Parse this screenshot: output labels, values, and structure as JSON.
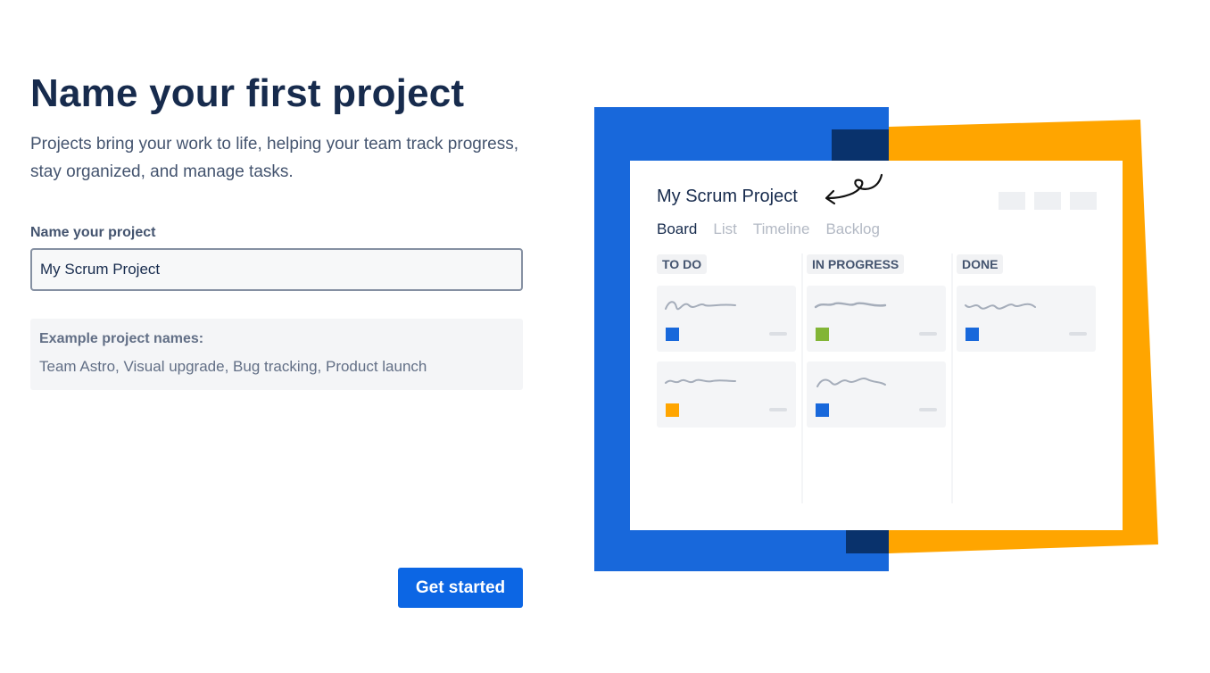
{
  "heading": "Name your first project",
  "subtitle": "Projects bring your work to life, helping your team track progress, stay organized, and manage tasks.",
  "form": {
    "label": "Name your project",
    "value": "My Scrum Project"
  },
  "examples": {
    "title": "Example project names:",
    "body": "Team Astro, Visual upgrade, Bug tracking, Product launch"
  },
  "cta": {
    "label": "Get started"
  },
  "preview": {
    "project_title": "My Scrum Project",
    "tabs": [
      "Board",
      "List",
      "Timeline",
      "Backlog"
    ],
    "active_tab": "Board",
    "columns": [
      {
        "name": "TO DO",
        "cards": [
          {
            "color": "#1868DB"
          },
          {
            "color": "#FFA500"
          }
        ]
      },
      {
        "name": "IN PROGRESS",
        "cards": [
          {
            "color": "#82B536"
          },
          {
            "color": "#1868DB"
          }
        ]
      },
      {
        "name": "DONE",
        "cards": [
          {
            "color": "#1868DB"
          }
        ]
      }
    ]
  },
  "colors": {
    "primary": "#0C66E4",
    "brand_blue": "#1868DB",
    "brand_yellow": "#FFA500",
    "navy": "#09326C"
  }
}
